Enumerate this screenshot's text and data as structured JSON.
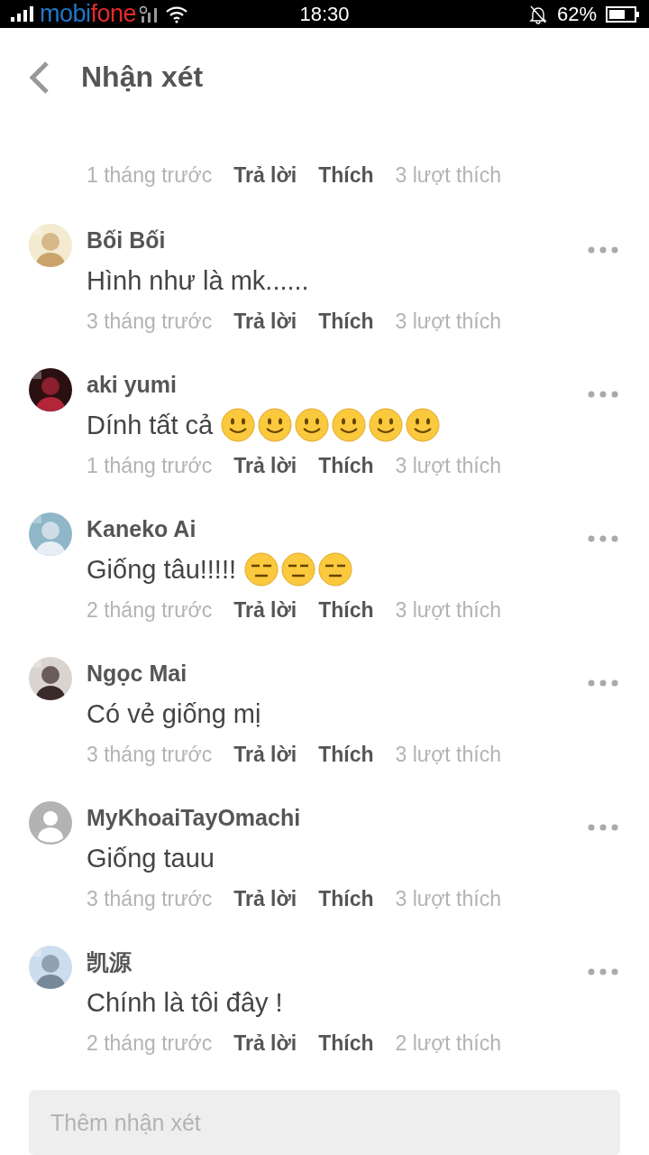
{
  "status_bar": {
    "carrier": [
      "mobi",
      "fone"
    ],
    "time": "18:30",
    "battery": "62%"
  },
  "header": {
    "title": "Nhận xét"
  },
  "partial_comment": {
    "time": "1 tháng trước",
    "reply": "Trả lời",
    "like": "Thích",
    "likes": "3 lượt thích"
  },
  "comments": [
    {
      "name": "Bối Bối",
      "text": "Hình như là mk......",
      "time": "3 tháng trước",
      "reply": "Trả lời",
      "like": "Thích",
      "likes": "3 lượt thích"
    },
    {
      "name": "aki yumi",
      "text": "Dính tất cả",
      "emojis": [
        {
          "kind": "smile"
        },
        {
          "kind": "smile"
        },
        {
          "kind": "smile"
        },
        {
          "kind": "smile"
        },
        {
          "kind": "smile"
        },
        {
          "kind": "smile"
        }
      ],
      "time": "1 tháng trước",
      "reply": "Trả lời",
      "like": "Thích",
      "likes": "3 lượt thích"
    },
    {
      "name": "Kaneko Ai",
      "text": "Giống tâu!!!!!",
      "emojis": [
        {
          "kind": "expressionless"
        },
        {
          "kind": "expressionless"
        },
        {
          "kind": "expressionless"
        }
      ],
      "time": "2 tháng trước",
      "reply": "Trả lời",
      "like": "Thích",
      "likes": "3 lượt thích"
    },
    {
      "name": "Ngọc Mai",
      "text": "Có vẻ giống mị",
      "time": "3 tháng trước",
      "reply": "Trả lời",
      "like": "Thích",
      "likes": "3 lượt thích"
    },
    {
      "name": "MyKhoaiTayOmachi",
      "avatar": {
        "kind": "default"
      },
      "text": "Giống tauu",
      "time": "3 tháng trước",
      "reply": "Trả lời",
      "like": "Thích",
      "likes": "3 lượt thích"
    },
    {
      "name": "凯源",
      "text": "Chính là tôi đây !",
      "time": "2 tháng trước",
      "reply": "Trả lời",
      "like": "Thích",
      "likes": "2 lượt thích"
    }
  ],
  "input": {
    "placeholder": "Thêm nhận xét"
  }
}
